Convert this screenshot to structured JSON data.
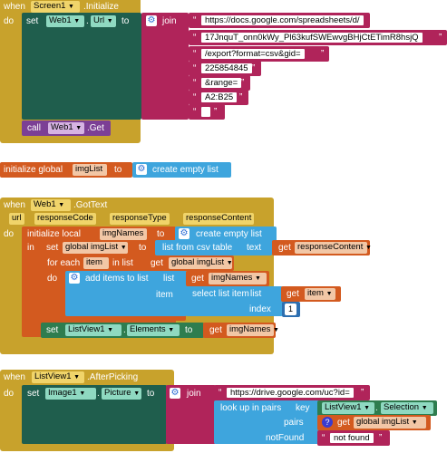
{
  "screen_init": {
    "when": "when",
    "component": "Screen1",
    "event": ".Initialize",
    "do": "do",
    "set": "set",
    "target": "Web1",
    "prop": "Url",
    "to": "to",
    "join": "join",
    "strings": [
      "https://docs.google.com/spreadsheets/d/",
      "17JnquT_onn0kWy_Pl63kufSWEwvgBHjCtETimR8hsjQ",
      "/export?format=csv&gid=",
      "225854845",
      "&range=",
      "A2:B25",
      ""
    ],
    "call": "call",
    "call_component": "Web1",
    "call_method": ".Get"
  },
  "global_init": {
    "label": "initialize global",
    "name": "imgList",
    "to": "to",
    "value": "create empty list"
  },
  "gottext": {
    "when": "when",
    "component": "Web1",
    "event": ".GotText",
    "params": [
      "url",
      "responseCode",
      "responseType",
      "responseContent"
    ],
    "do": "do",
    "init_local": "initialize local",
    "local_name": "imgNames",
    "to": "to",
    "local_value": "create empty list",
    "in": "in",
    "set": "set",
    "set_var": "global imgList",
    "to2": "to",
    "from_csv": "list from csv table",
    "text": "text",
    "get": "get",
    "get_response": "responseContent",
    "foreach": "for each",
    "item": "item",
    "in_list": "in list",
    "get_global": "global imgList",
    "do2": "do",
    "add_items": "add items to list",
    "list": "list",
    "get_names": "imgNames",
    "item_label": "item",
    "select_item": "select list item",
    "list_label": "list",
    "get_item": "item",
    "index": "index",
    "index_value": "1",
    "set2": "set",
    "lv": "ListView1",
    "elements": "Elements",
    "to3": "to",
    "get_names2": "imgNames"
  },
  "afterpicking": {
    "when": "when",
    "component": "ListView1",
    "event": ".AfterPicking",
    "do": "do",
    "set": "set",
    "target": "Image1",
    "prop": "Picture",
    "to": "to",
    "join": "join",
    "url": "https://drive.google.com/uc?id=",
    "lookup": "look up in pairs",
    "key": "key",
    "key_comp": "ListView1",
    "key_prop": "Selection",
    "pairs": "pairs",
    "pairs_get": "get",
    "pairs_var": "global imgList",
    "notfound": "notFound",
    "notfound_value": "not found"
  }
}
